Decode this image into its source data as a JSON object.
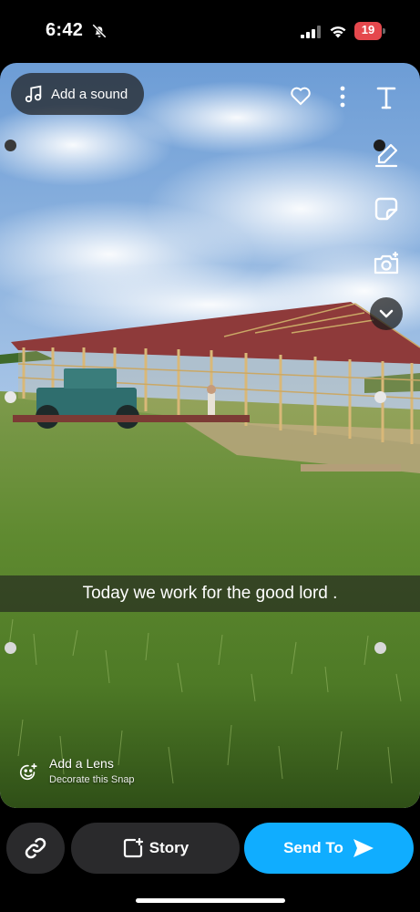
{
  "status_bar": {
    "time": "6:42",
    "battery_level": "19",
    "icons": [
      "bell-slash-icon",
      "cellular-signal-icon",
      "wifi-icon",
      "battery-icon"
    ],
    "battery_color": "#e5484d"
  },
  "snap": {
    "sound_label": "Add a sound",
    "caption": "Today we work for the good lord .",
    "lens_title": "Add a Lens",
    "lens_subtitle": "Decorate this Snap",
    "top_icons": [
      "music-note-icon",
      "heart-icon",
      "more-vertical-icon"
    ],
    "toolbar_icons": [
      "text-tool-icon",
      "draw-pen-icon",
      "sticker-icon",
      "camera-plus-icon",
      "chevron-down-icon"
    ]
  },
  "bottom_bar": {
    "story_label": "Story",
    "send_label": "Send To",
    "icons": [
      "link-icon",
      "story-add-icon",
      "send-arrow-icon"
    ]
  },
  "colors": {
    "send_button": "#10adff",
    "secondary_button": "#2a2a2c"
  }
}
